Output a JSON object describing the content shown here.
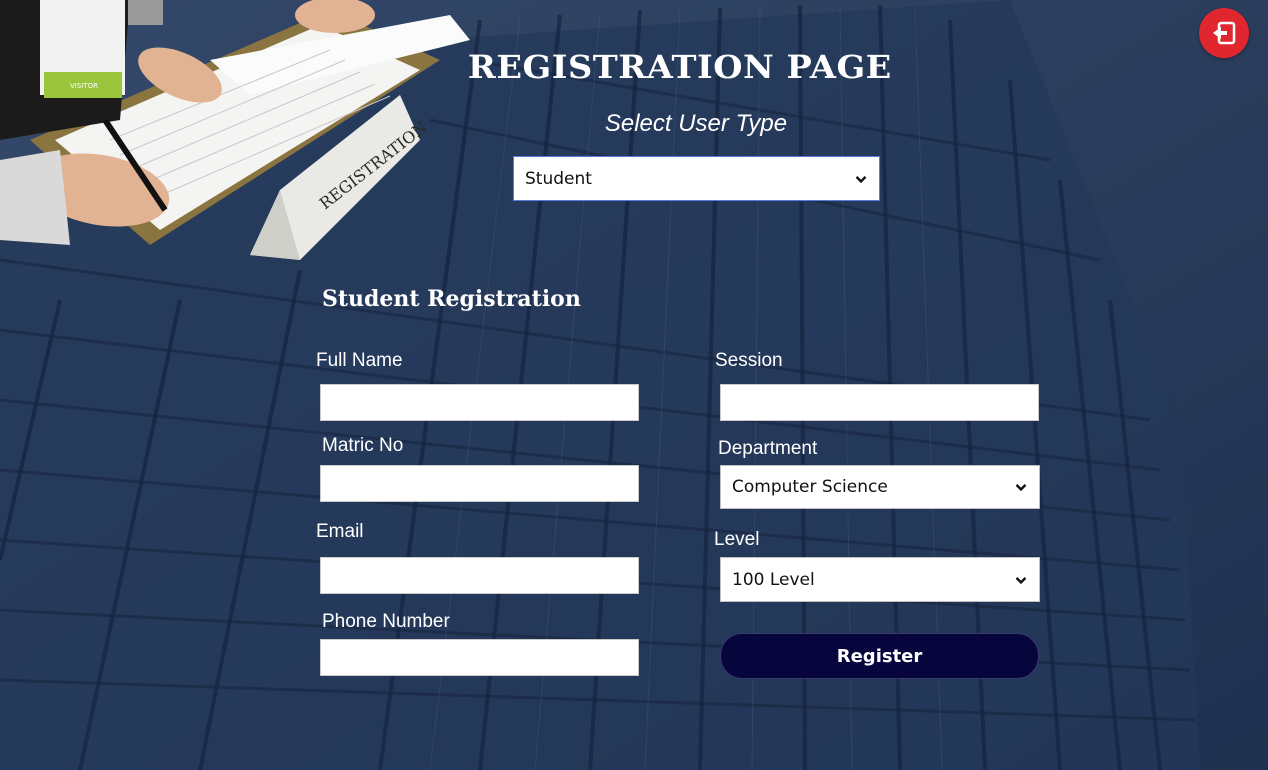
{
  "header": {
    "title": "REGISTRATION PAGE",
    "subtitle": "Select User Type",
    "user_type": {
      "selected": "Student"
    },
    "exit_icon": "exit-icon"
  },
  "photo": {
    "badge_text": "VISITOR",
    "sign_text": "REGISTRATION"
  },
  "form": {
    "section_title": "Student Registration",
    "full_name": {
      "label": "Full Name",
      "value": ""
    },
    "matric_no": {
      "label": "Matric No",
      "value": ""
    },
    "email": {
      "label": "Email",
      "value": ""
    },
    "phone": {
      "label": "Phone Number",
      "value": ""
    },
    "session": {
      "label": "Session",
      "value": ""
    },
    "department": {
      "label": "Department",
      "selected": "Computer Science"
    },
    "level": {
      "label": "Level",
      "selected": "100 Level"
    },
    "register_label": "Register"
  },
  "colors": {
    "background": "#2b3f5c",
    "exit_button": "#e0262e",
    "register_button": "#06063d"
  }
}
